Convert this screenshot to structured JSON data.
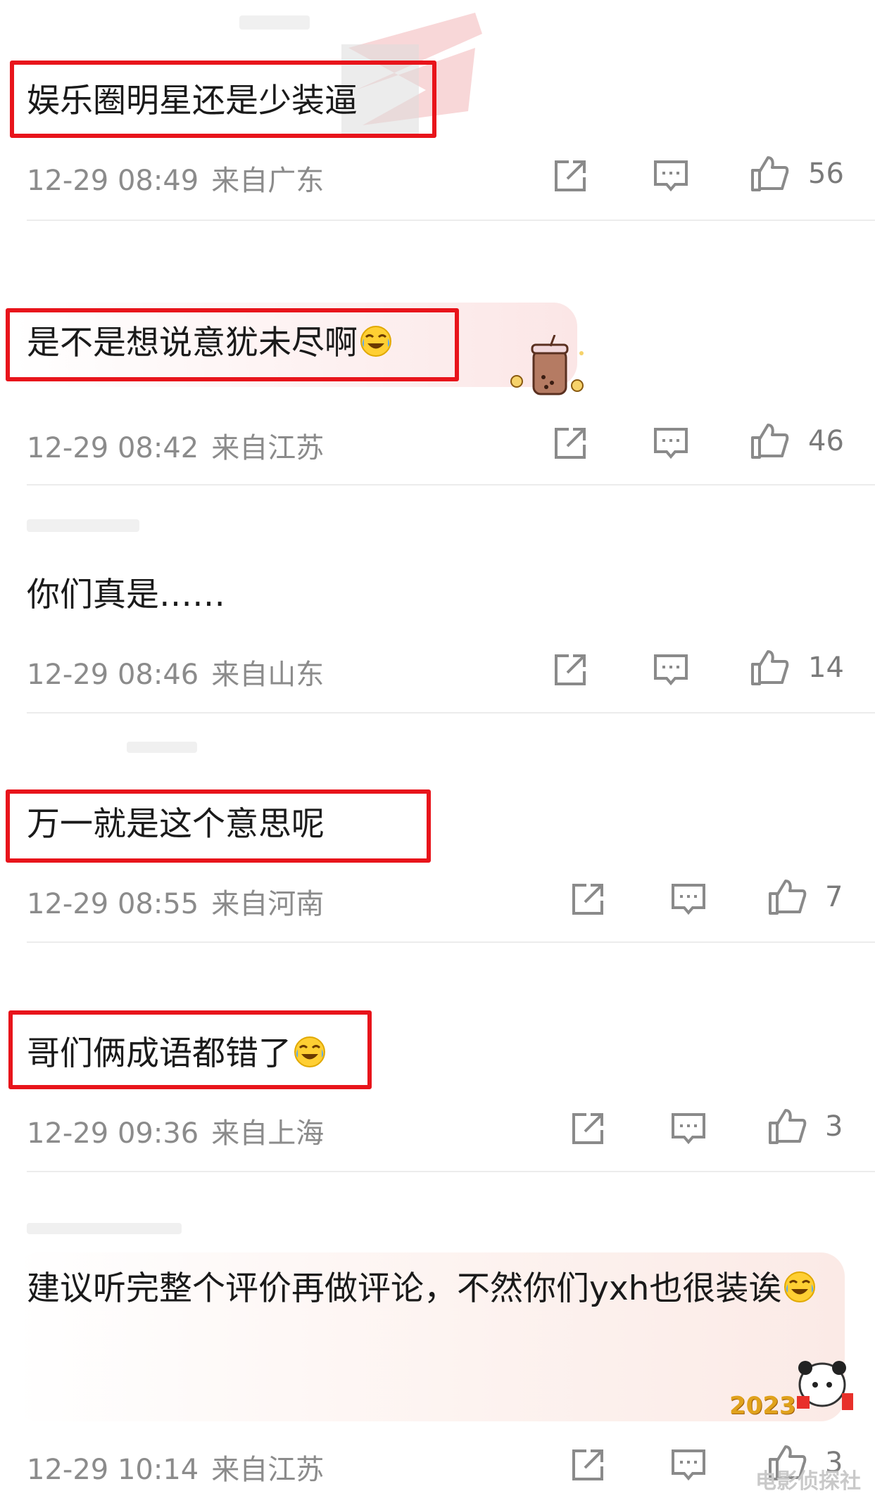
{
  "comments": [
    {
      "text": "娱乐圈明星还是少装逼",
      "time": "12-29 08:49",
      "location": "来自广东",
      "likes": "56",
      "emoji": ""
    },
    {
      "text": "是不是想说意犹未尽啊",
      "time": "12-29 08:42",
      "location": "来自江苏",
      "likes": "46",
      "emoji": "laugh-cry-emoji"
    },
    {
      "text": "你们真是……",
      "time": "12-29 08:46",
      "location": "来自山东",
      "likes": "14",
      "emoji": ""
    },
    {
      "text": "万一就是这个意思呢",
      "time": "12-29 08:55",
      "location": "来自河南",
      "likes": "7",
      "emoji": ""
    },
    {
      "text": "哥们俩成语都错了",
      "time": "12-29 09:36",
      "location": "来自上海",
      "likes": "3",
      "emoji": "laugh-cry-emoji"
    },
    {
      "text": "建议听完整个评价再做评论，不然你们yxh也很装诶",
      "time": "12-29 10:14",
      "location": "来自江苏",
      "likes": "3",
      "emoji": "laugh-cry-emoji"
    }
  ],
  "sticker_year": "2023",
  "watermark": "电影侦探社",
  "colors": {
    "highlight_box": "#e8141b",
    "meta_text": "#8b8b8b",
    "icon": "#8a8a8a"
  },
  "icons": [
    "share-icon",
    "comment-icon",
    "thumbs-up-icon"
  ]
}
